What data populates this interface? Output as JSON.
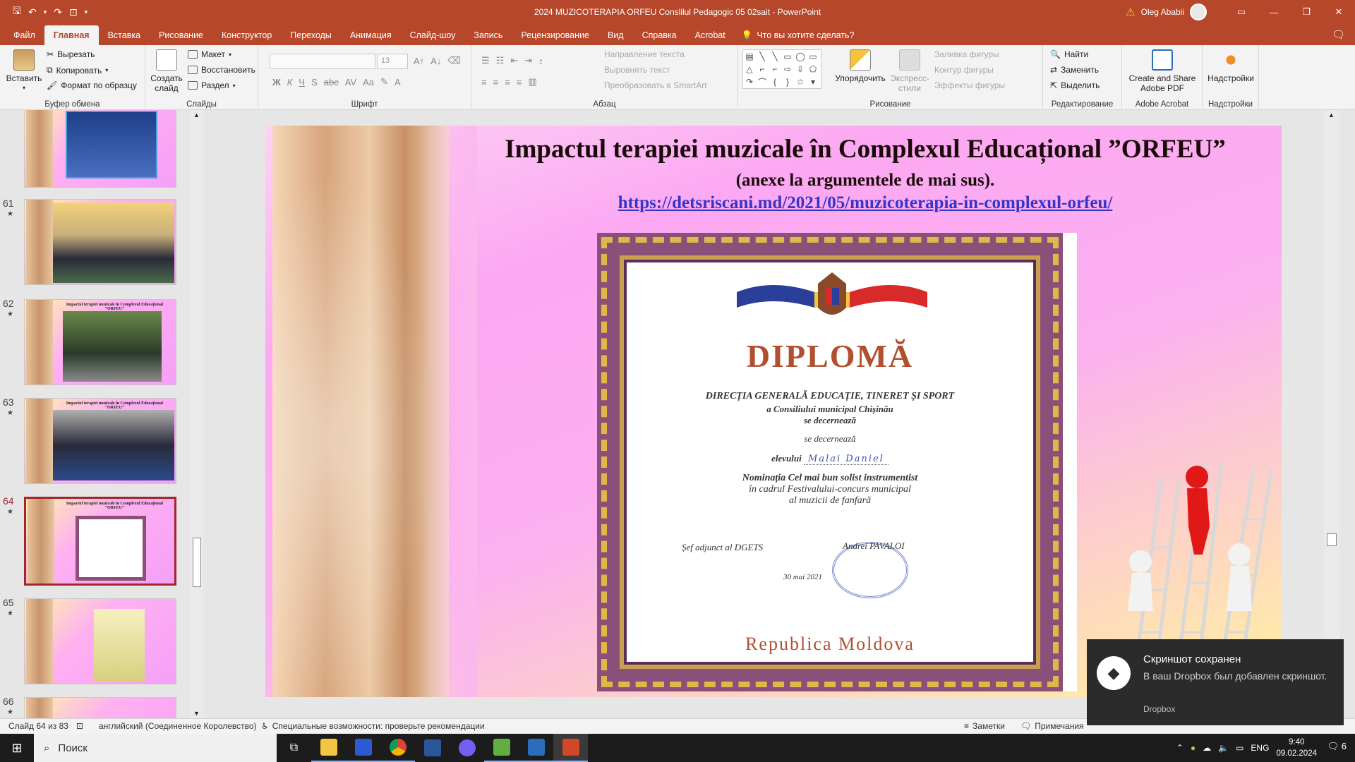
{
  "window": {
    "doc_title": "2024 MUZICOTERAPIA ORFEU Conslilul Pedagogic 05 02sait  -  PowerPoint",
    "user_name": "Oleg Ababii"
  },
  "menu": {
    "tabs": [
      "Файл",
      "Главная",
      "Вставка",
      "Рисование",
      "Конструктор",
      "Переходы",
      "Анимация",
      "Слайд-шоу",
      "Запись",
      "Рецензирование",
      "Вид",
      "Справка",
      "Acrobat"
    ],
    "tell_me": "Что вы хотите сделать?"
  },
  "ribbon": {
    "clipboard": {
      "paste": "Вставить",
      "cut": "Вырезать",
      "copy": "Копировать",
      "format_painter": "Формат по образцу",
      "label": "Буфер обмена"
    },
    "slides": {
      "new_slide_1": "Создать",
      "new_slide_2": "слайд",
      "layout": "Макет",
      "reset": "Восстановить",
      "section": "Раздел",
      "label": "Слайды"
    },
    "font": {
      "size": "13",
      "label": "Шрифт"
    },
    "paragraph": {
      "text_direction": "Направление текста",
      "align_text": "Выровнять текст",
      "smartart": "Преобразовать в SmartArt",
      "label": "Абзац"
    },
    "drawing": {
      "arrange": "Упорядочить",
      "quick_styles_1": "Экспресс-",
      "quick_styles_2": "стили",
      "fill": "Заливка фигуры",
      "outline": "Контур фигуры",
      "effects": "Эффекты фигуры",
      "label": "Рисование"
    },
    "editing": {
      "find": "Найти",
      "replace": "Заменить",
      "select": "Выделить",
      "label": "Редактирование"
    },
    "acrobat": {
      "btn_1": "Create and Share",
      "btn_2": "Adobe PDF",
      "label": "Adobe Acrobat"
    },
    "addins": {
      "btn": "Надстройки",
      "label": "Надстройки"
    }
  },
  "thumbnails": [
    {
      "num": "",
      "title": ""
    },
    {
      "num": "61",
      "title": ""
    },
    {
      "num": "62",
      "title": "Impactul terapiei muzicale în Complexul Educațional ”ORFEU”"
    },
    {
      "num": "63",
      "title": "Impactul terapiei muzicale în Complexul Educațional ”ORFEU”"
    },
    {
      "num": "64",
      "title": "Impactul terapiei muzicale în Complexul Educațional ”ORFEU”"
    },
    {
      "num": "65",
      "title": ""
    },
    {
      "num": "66",
      "title": ""
    }
  ],
  "slide": {
    "title": "Impactul terapiei muzicale în Complexul Educațional ”ORFEU”",
    "subtitle": "(anexe la argumentele de mai sus).",
    "link": "https://detsriscani.md/2021/05/muzicoterapia-in-complexul-orfeu/"
  },
  "diploma": {
    "title": "DIPLOMĂ",
    "line1": "DIRECȚIA GENERALĂ EDUCAȚIE, TINERET ȘI SPORT",
    "line2": "a Consiliului municipal Chișinău",
    "line3": "se decernează",
    "line4": "se decernează",
    "student_label": "elevului",
    "student_name": "Malai Daniel",
    "nomination": "Nominația Cel mai bun solist instrumentist",
    "festival1": "în cadrul Festivalului-concurs municipal",
    "festival2": "al muzicii de fanfară",
    "signer_role": "Șef adjunct  al DGETS",
    "signer_name": "Andrei PAVALOI",
    "date": "30 mai 2021",
    "country": "Republica Moldova"
  },
  "toast": {
    "title": "Скриншот сохранен",
    "body": "В ваш Dropbox был добавлен скриншот.",
    "app": "Dropbox"
  },
  "status": {
    "slide_of": "Слайд 64 из 83",
    "language": "английский (Соединенное Королевство)",
    "accessibility": "Специальные возможности: проверьте рекомендации",
    "notes": "Заметки",
    "comments": "Примечания"
  },
  "taskbar": {
    "search": "Поиск",
    "lang": "ENG",
    "time": "9:40",
    "date": "09.02.2024",
    "notif_count": "6"
  },
  "colors": {
    "accent": "#b7472a",
    "selected_thumb": "#a4262c"
  }
}
